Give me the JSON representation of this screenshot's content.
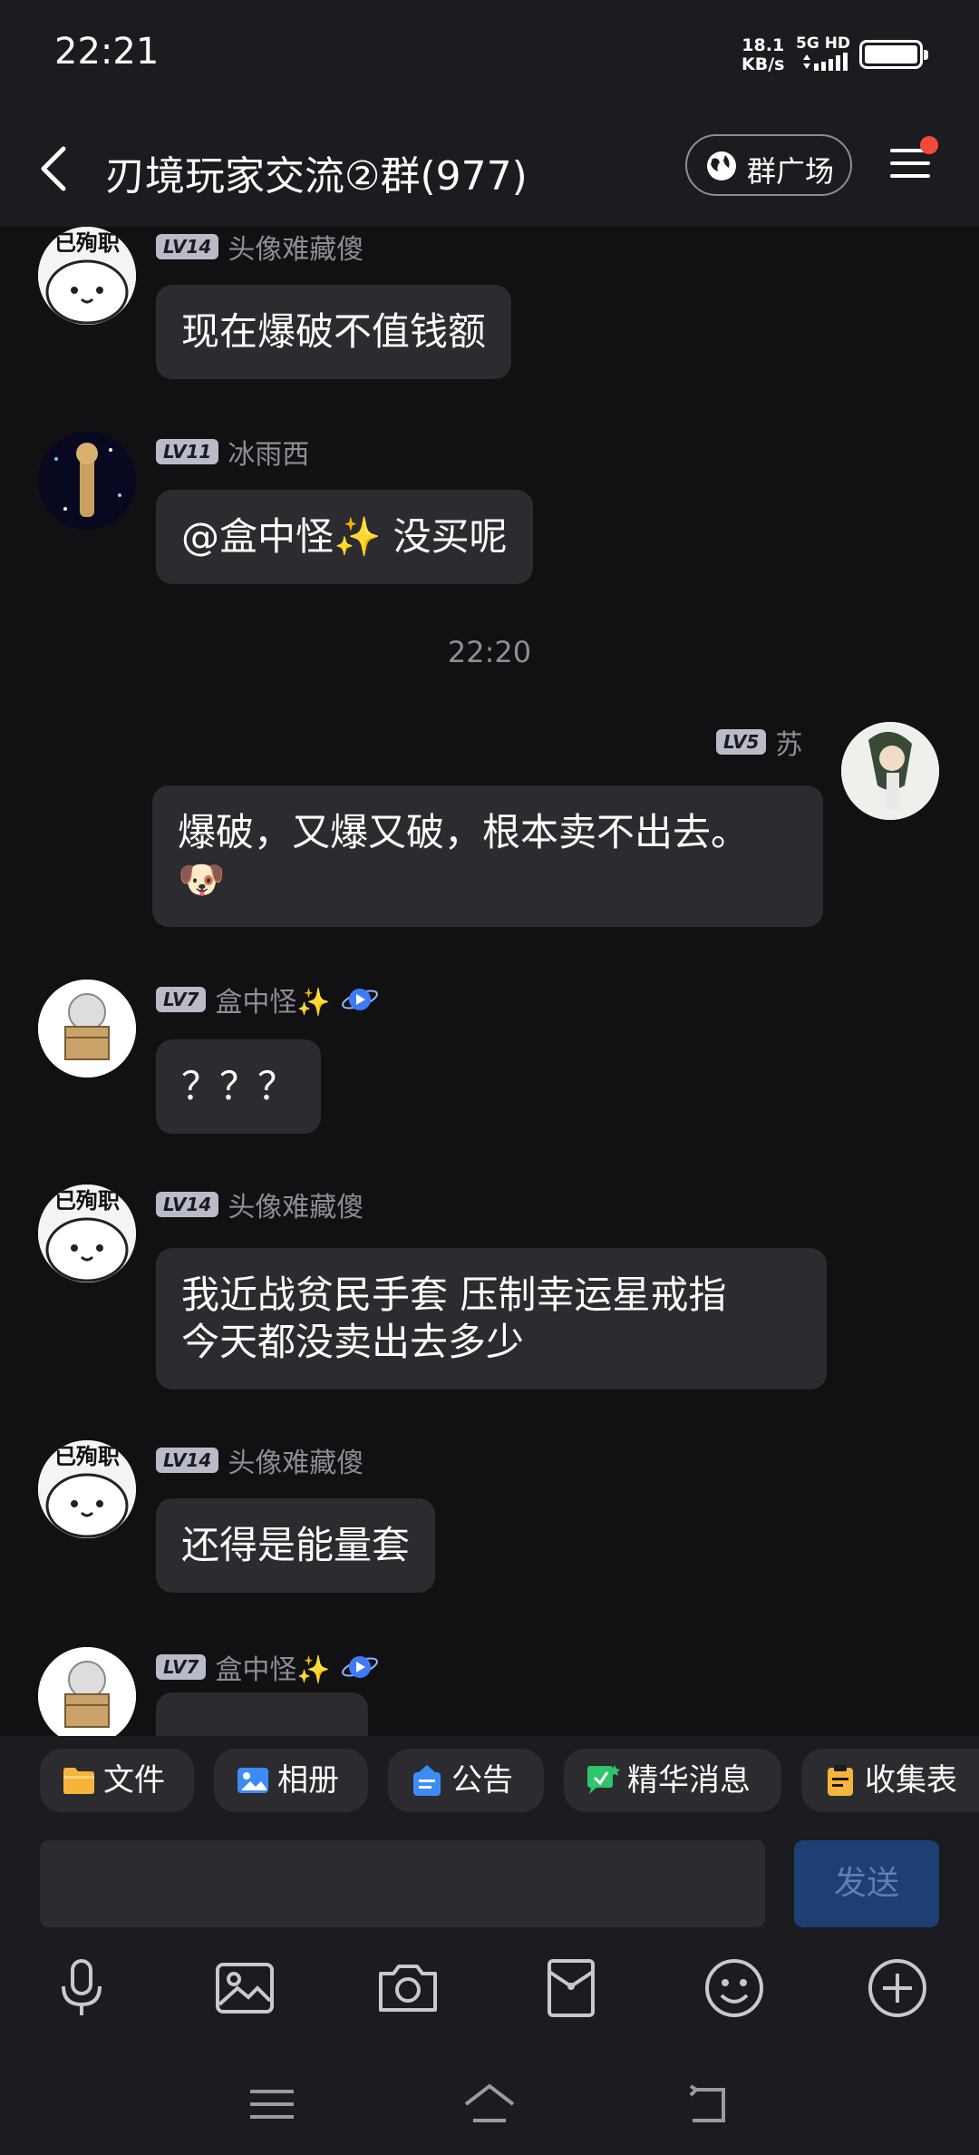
{
  "status_bar": {
    "time": "22:21",
    "net_speed": "18.1",
    "net_unit": "KB/s",
    "network": "5G HD",
    "battery_level": 1.0
  },
  "header": {
    "back_icon": "chevron-left-icon",
    "title": "刃境玩家交流②群(977)",
    "square_label": "群广场",
    "menu_icon": "hamburger-menu-icon",
    "has_notification": true
  },
  "messages": [
    {
      "side": "left",
      "level": "LV14",
      "name": "头像难藏傻",
      "avatar_text": "已殉职",
      "text": "现在爆破不值钱额"
    },
    {
      "side": "left",
      "level": "LV11",
      "name": "冰雨西",
      "text": "@盒中怪✨ 没买呢"
    },
    {
      "timestamp": "22:20"
    },
    {
      "side": "right",
      "level": "LV5",
      "name": "苏",
      "text": "爆破，又爆又破，根本卖不出去。",
      "emoji": "🐶"
    },
    {
      "side": "left",
      "level": "LV7",
      "name": "盒中怪✨",
      "text": "？？？"
    },
    {
      "side": "left",
      "level": "LV14",
      "name": "头像难藏傻",
      "avatar_text": "已殉职",
      "text_line1": "我近战贫民手套 压制幸运星戒指",
      "text_line2": "今天都没卖出去多少"
    },
    {
      "side": "left",
      "level": "LV14",
      "name": "头像难藏傻",
      "avatar_text": "已殉职",
      "text": "还得是能量套"
    },
    {
      "side": "left",
      "level": "LV7",
      "name": "盒中怪✨",
      "text": ""
    }
  ],
  "shortcuts": [
    {
      "label": "文件",
      "icon": "folder-icon",
      "color": "#f5b53d"
    },
    {
      "label": "相册",
      "icon": "photo-album-icon",
      "color": "#3d8cf5"
    },
    {
      "label": "公告",
      "icon": "announcement-icon",
      "color": "#3d8cf5"
    },
    {
      "label": "精华消息",
      "icon": "essence-message-icon",
      "color": "#2fc56a"
    },
    {
      "label": "收集表",
      "icon": "clipboard-icon",
      "color": "#f5b53d"
    }
  ],
  "input": {
    "placeholder": "",
    "send_label": "发送"
  },
  "toolbar": [
    "microphone-icon",
    "image-icon",
    "camera-icon",
    "red-packet-icon",
    "emoji-icon",
    "plus-icon"
  ],
  "nav": [
    "menu-icon",
    "home-icon",
    "back-icon"
  ]
}
